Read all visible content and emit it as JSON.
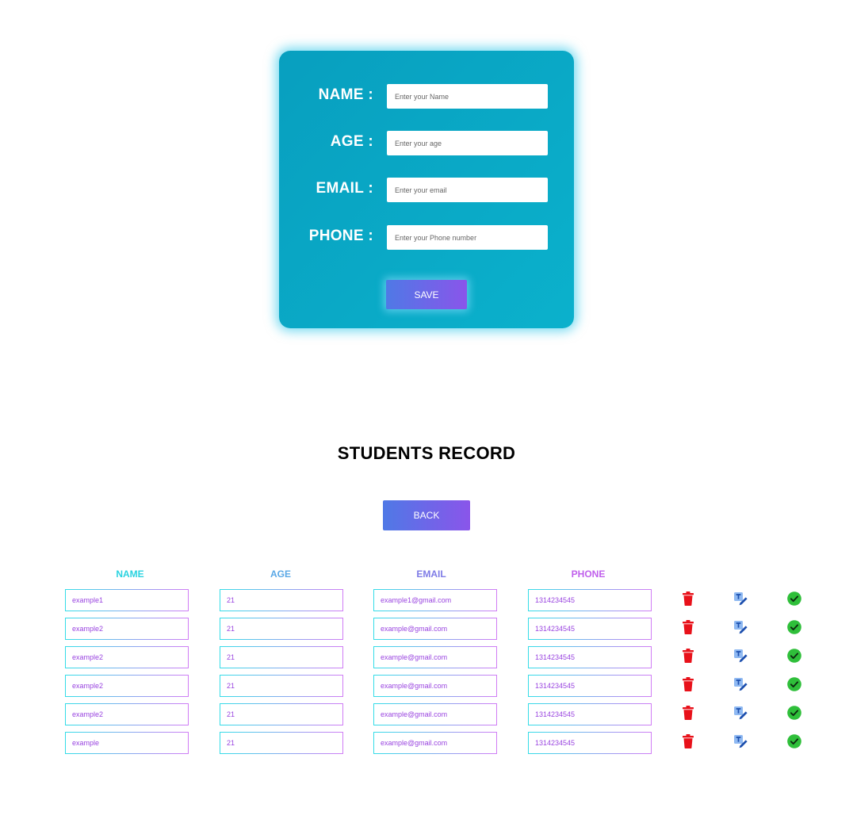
{
  "form": {
    "fields": [
      {
        "label": "NAME :",
        "placeholder": "Enter your Name"
      },
      {
        "label": "AGE :",
        "placeholder": "Enter your age"
      },
      {
        "label": "EMAIL :",
        "placeholder": "Enter your email"
      },
      {
        "label": "PHONE :",
        "placeholder": "Enter your Phone number"
      }
    ],
    "save_label": "SAVE"
  },
  "records": {
    "title": "STUDENTS RECORD",
    "back_label": "BACK",
    "headers": [
      {
        "label": "NAME",
        "color": "#2ad3e0"
      },
      {
        "label": "AGE",
        "color": "#5aa8e6"
      },
      {
        "label": "EMAIL",
        "color": "#7e7be6"
      },
      {
        "label": "PHONE",
        "color": "#c060ec"
      }
    ],
    "rows": [
      {
        "name": "example1",
        "age": "21",
        "email": "example1@gmail.com",
        "phone": "1314234545"
      },
      {
        "name": "example2",
        "age": "21",
        "email": "example@gmail.com",
        "phone": "1314234545"
      },
      {
        "name": "example2",
        "age": "21",
        "email": "example@gmail.com",
        "phone": "1314234545"
      },
      {
        "name": "example2",
        "age": "21",
        "email": "example@gmail.com",
        "phone": "1314234545"
      },
      {
        "name": "example2",
        "age": "21",
        "email": "example@gmail.com",
        "phone": "1314234545"
      },
      {
        "name": "example",
        "age": "21",
        "email": "example@gmail.com",
        "phone": "1314234545"
      }
    ],
    "row_actions": [
      "trash-icon",
      "edit-icon",
      "check-circle-icon"
    ]
  },
  "colors": {
    "card": "#0aa8c6",
    "button_gradient_start": "#4f79e6",
    "button_gradient_end": "#8a55ea",
    "delete": "#e8111a",
    "edit": "#3b7fe0",
    "confirm": "#2fbf3a"
  }
}
